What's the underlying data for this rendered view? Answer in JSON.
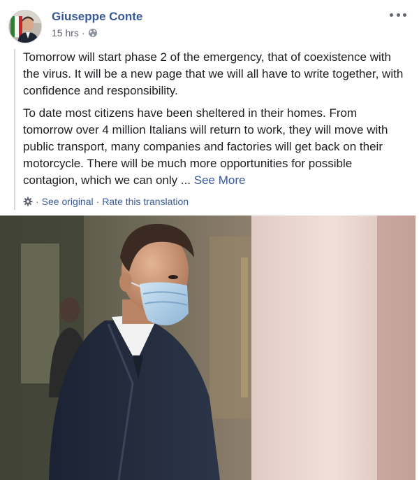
{
  "post": {
    "author": "Giuseppe Conte",
    "time": "15 hrs",
    "dot": "·",
    "paragraphs": [
      "Tomorrow will start phase 2 of the emergency, that of coexistence with the virus. It will be a new page that we will all have to write together, with confidence and responsibility.",
      "To date most citizens have been sheltered in their homes. From tomorrow over 4 million Italians will return to work, they will move with public transport, many companies and factories will get back on their motorcycle. There will be much more opportunities for possible contagion, which we can only ..."
    ],
    "see_more": "See More",
    "translation": {
      "sep1": "·",
      "see_original": "See original",
      "sep2": "·",
      "rate": "Rate this translation"
    },
    "icons": {
      "privacy": "globe-icon",
      "options": "more-options-icon",
      "translation": "gear-icon"
    },
    "colors": {
      "link": "#385898",
      "text": "#1c1e21",
      "meta": "#616770"
    }
  }
}
